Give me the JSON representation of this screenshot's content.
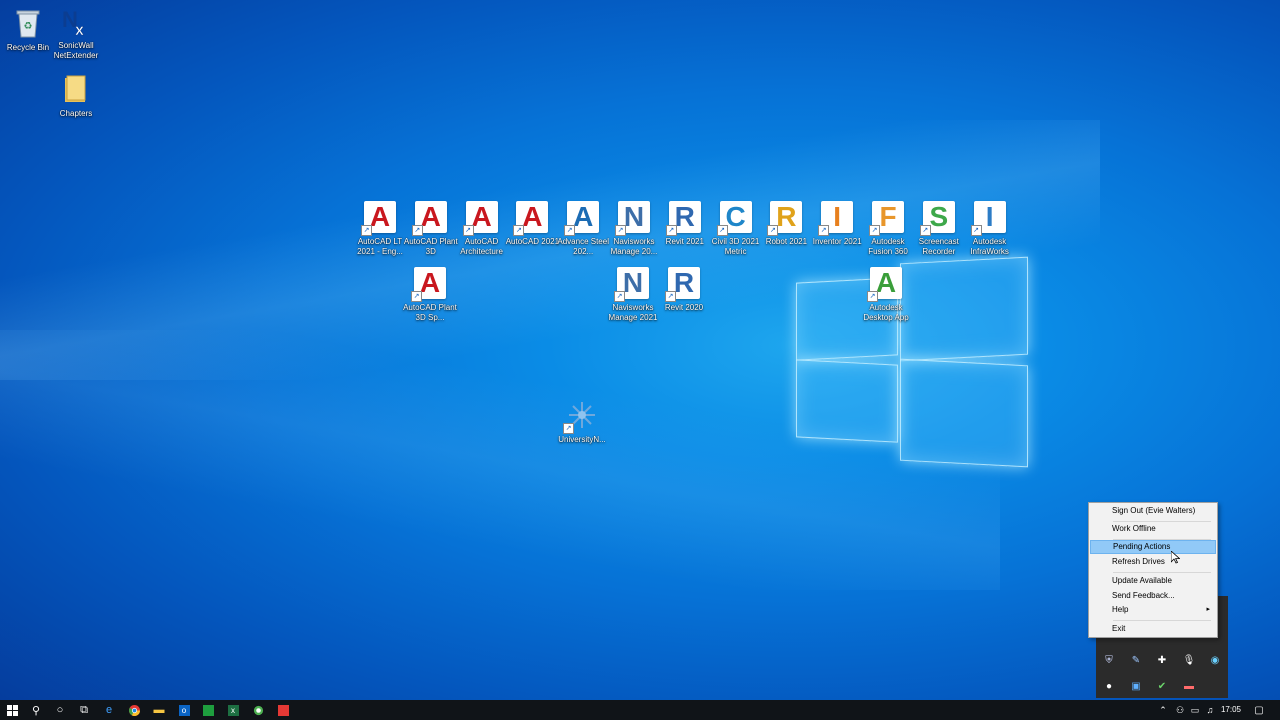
{
  "desktop": {
    "corner_icons": [
      {
        "label": "Recycle Bin"
      },
      {
        "label": "SonicWall NetExtender"
      },
      {
        "label": "Chapters"
      }
    ],
    "row1": [
      {
        "label": "AutoCAD LT 2021 - Eng...",
        "letter": "A",
        "color": "#c9171e"
      },
      {
        "label": "AutoCAD Plant 3D",
        "letter": "A",
        "color": "#c9171e"
      },
      {
        "label": "AutoCAD Architecture",
        "letter": "A",
        "color": "#c9171e"
      },
      {
        "label": "AutoCAD 2021",
        "letter": "A",
        "color": "#c9171e"
      },
      {
        "label": "Advance Steel 202...",
        "letter": "A",
        "color": "#1c6cb4"
      },
      {
        "label": "Navisworks Manage 20...",
        "letter": "N",
        "color": "#3d6ea8"
      },
      {
        "label": "Revit 2021",
        "letter": "R",
        "color": "#2f68b0"
      },
      {
        "label": "Civil 3D 2021 Metric",
        "letter": "C",
        "color": "#1f86c9"
      },
      {
        "label": "Robot 2021",
        "letter": "R",
        "color": "#e0a21a"
      },
      {
        "label": "Inventor 2021",
        "letter": "I",
        "color": "#e7801e"
      },
      {
        "label": "Autodesk Fusion 360",
        "letter": "F",
        "color": "#e8962b"
      },
      {
        "label": "Screencast Recorder",
        "letter": "S",
        "color": "#3ea84a"
      },
      {
        "label": "Autodesk InfraWorks",
        "letter": "I",
        "color": "#2c7cc6"
      }
    ],
    "row2": [
      {
        "label": "AutoCAD Plant 3D Sp...",
        "letter": "A",
        "color": "#c9171e"
      },
      {
        "label": "Navisworks Manage 2021",
        "letter": "N",
        "color": "#3d6ea8"
      },
      {
        "label": "Revit 2020",
        "letter": "R",
        "color": "#2f68b0"
      },
      {
        "label": "Autodesk Desktop App",
        "letter": "A",
        "color": "#3a9e3a"
      }
    ],
    "loose_icon": {
      "label": "UniversityN..."
    }
  },
  "context_menu": {
    "items": [
      {
        "label": "Sign Out (Evie Walters)"
      },
      {
        "label": "Work Offline"
      },
      {
        "label": "Pending Actions"
      },
      {
        "label": "Refresh Drives"
      },
      {
        "label": "Update Available"
      },
      {
        "label": "Send Feedback..."
      },
      {
        "label": "Help"
      },
      {
        "label": "Exit"
      }
    ],
    "highlighted": "Pending Actions"
  },
  "taskbar": {
    "clock": "17:05"
  },
  "colors": {
    "accent": "#91c9f7",
    "taskbar": "#101418"
  }
}
